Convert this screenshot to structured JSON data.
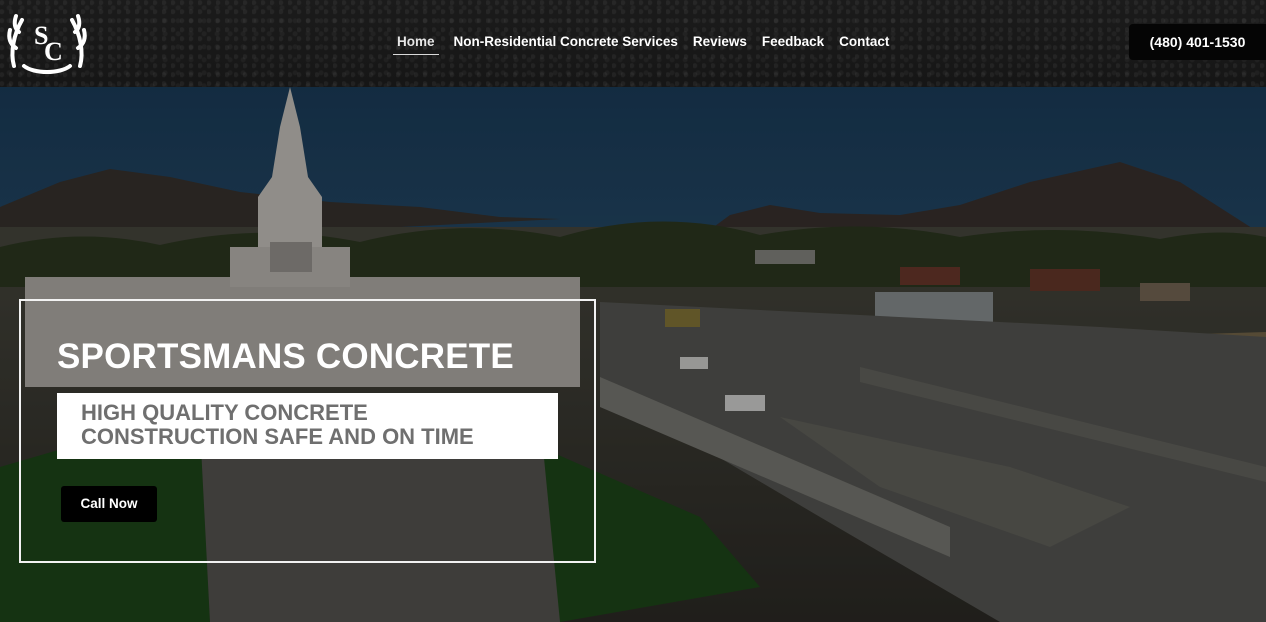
{
  "brand": {
    "logo_icon": "antler-monogram-sc-icon"
  },
  "nav": {
    "items": [
      {
        "label": "Home",
        "active": true
      },
      {
        "label": "Non-Residential Concrete Services",
        "active": false
      },
      {
        "label": "Reviews",
        "active": false
      },
      {
        "label": "Feedback",
        "active": false
      },
      {
        "label": "Contact",
        "active": false
      }
    ]
  },
  "header": {
    "phone": "(480) 401-1530"
  },
  "hero": {
    "title": "SPORTSMANS CONCRETE",
    "subtitle_line1": "HIGH QUALITY CONCRETE",
    "subtitle_line2": "CONSTRUCTION SAFE AND ON TIME",
    "cta_label": "Call Now"
  },
  "colors": {
    "header_bg": "#1a1a1a",
    "button_bg": "#000000",
    "subtitle_text": "#6f6f6f"
  }
}
